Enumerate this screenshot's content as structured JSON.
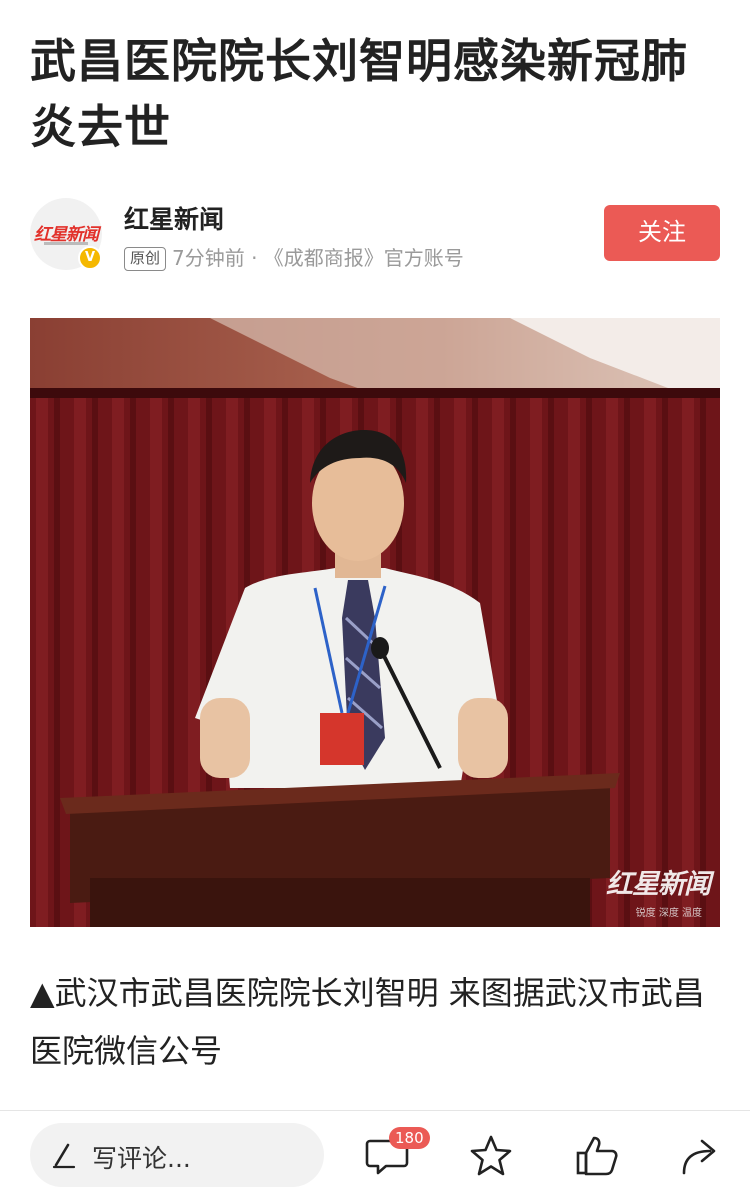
{
  "article": {
    "title": "武昌医院院长刘智明感染新冠肺炎去世",
    "caption": "▲武汉市武昌医院院长刘智明 来图据武汉市武昌医院微信公号"
  },
  "author": {
    "name": "红星新闻",
    "avatar_text": "红星新闻",
    "verified_badge": "V",
    "original_tag": "原创",
    "meta": "7分钟前 · 《成都商报》官方账号",
    "follow_label": "关注"
  },
  "photo": {
    "watermark": "红星新闻",
    "watermark_sub": "锐度 深度 温度"
  },
  "bottom_bar": {
    "comment_placeholder": "写评论...",
    "comment_count": "180",
    "icons": [
      "pen-icon",
      "comment-icon",
      "star-icon",
      "like-icon",
      "share-icon"
    ]
  },
  "colors": {
    "accent": "#eb5a55",
    "verified": "#f5b800"
  }
}
